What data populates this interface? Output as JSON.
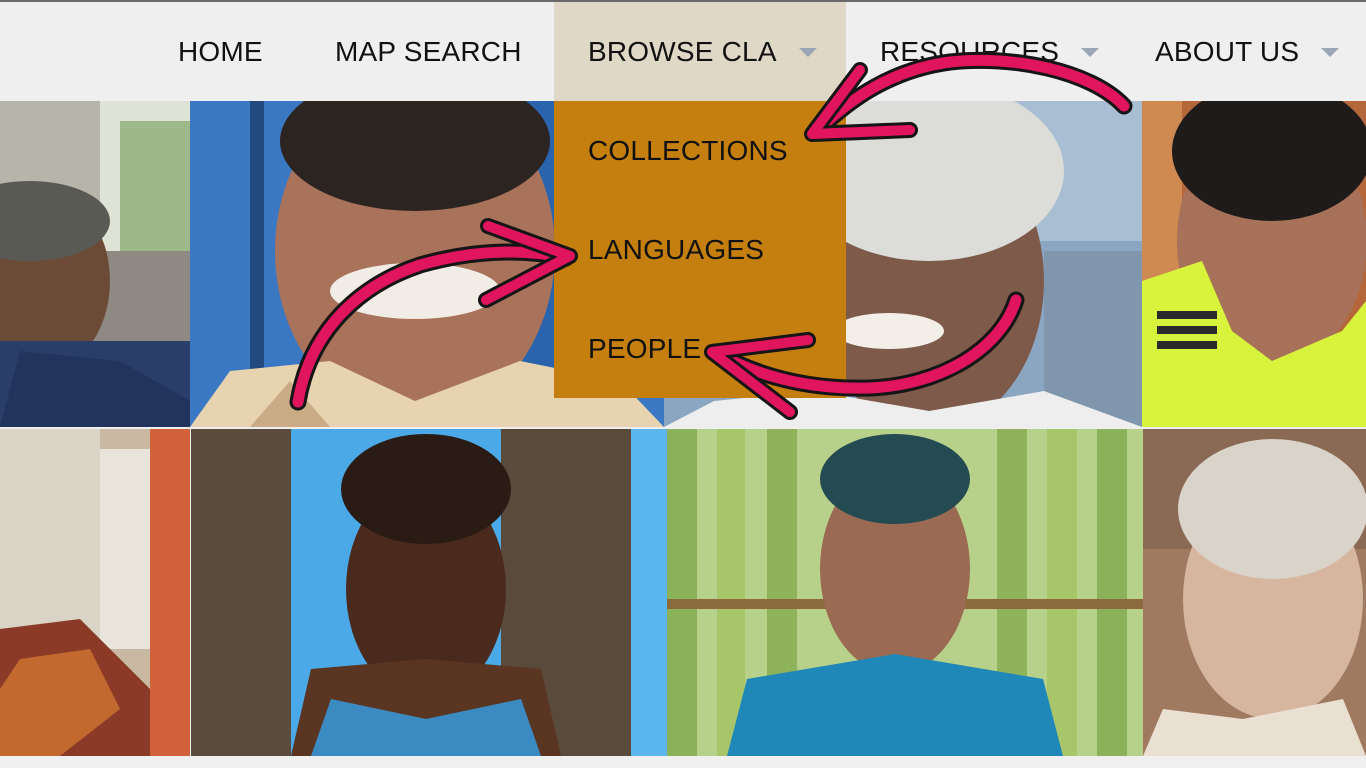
{
  "nav": {
    "items": [
      {
        "label": "HOME"
      },
      {
        "label": "MAP SEARCH"
      },
      {
        "label": "BROWSE CLA"
      },
      {
        "label": "RESOURCES"
      },
      {
        "label": "ABOUT US"
      }
    ]
  },
  "dropdown": {
    "items": [
      {
        "label": "COLLECTIONS"
      },
      {
        "label": "LANGUAGES"
      },
      {
        "label": "PEOPLE"
      }
    ]
  },
  "colors": {
    "nav_bg": "#efefef",
    "active_tab_bg": "#e0d8c6",
    "dropdown_bg": "#c47f0e",
    "caret": "#9aa5b6",
    "annotation_arrow": "#e0155e"
  },
  "icons": [
    "chevron-down-icon",
    "annotation-arrow"
  ]
}
